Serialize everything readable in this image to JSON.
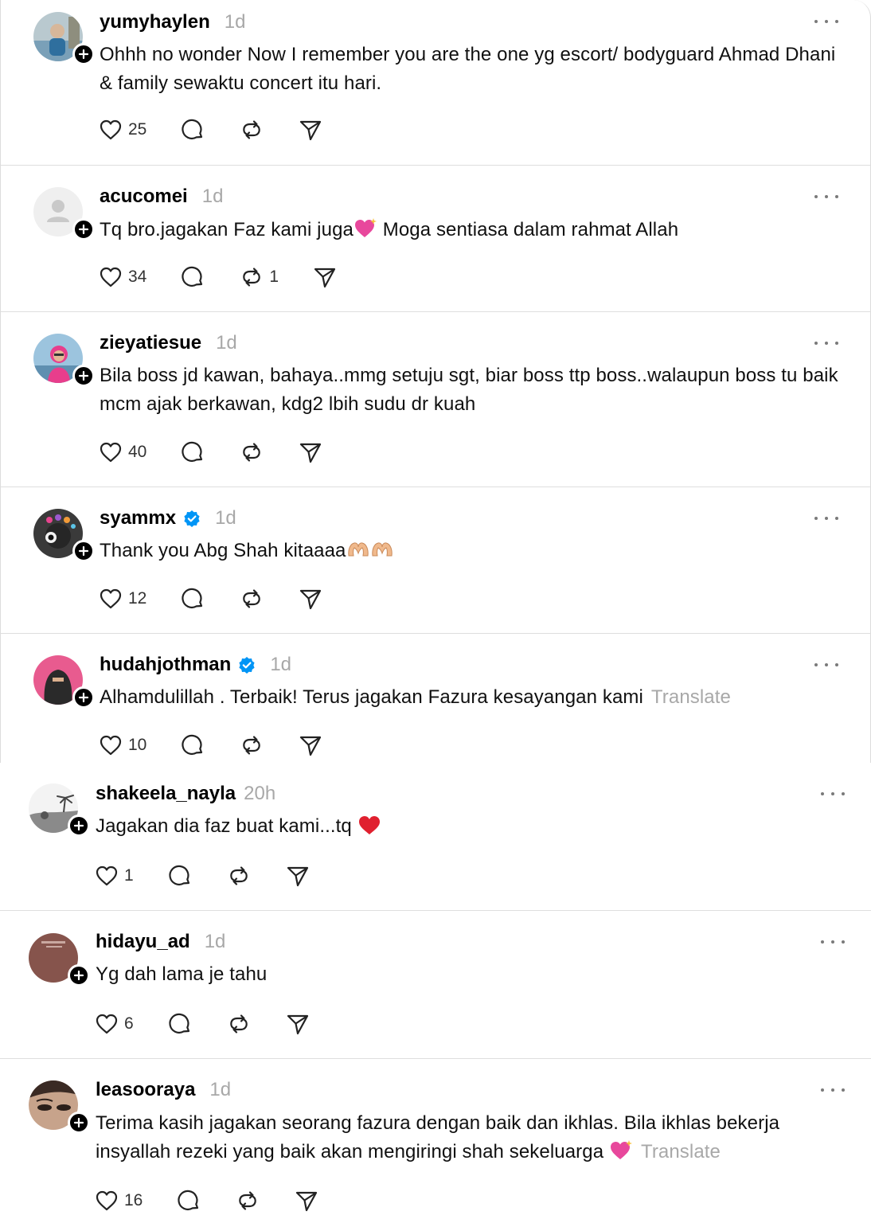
{
  "posts": [
    {
      "username": "yumyhaylen",
      "time": "1d",
      "verified": false,
      "text": "Ohhh no wonder Now I remember you are the one yg escort/ bodyguard Ahmad Dhani & family sewaktu concert itu hari.",
      "translate": "",
      "likes": "25",
      "replies": "",
      "reposts": "",
      "avatar_colors": [
        "#7aa0b8",
        "#2f6f9e"
      ]
    },
    {
      "username": "acucomei",
      "time": "1d",
      "verified": false,
      "text": "Tq bro.jagakan Faz kami juga",
      "text_after": " Moga sentiasa dalam rahmat Allah",
      "emoji": "sparkling-heart",
      "translate": "",
      "likes": "34",
      "replies": "",
      "reposts": "1",
      "avatar_colors": [
        "#e9e9e9",
        "#cfcfcf"
      ]
    },
    {
      "username": "zieyatiesue",
      "time": "1d",
      "verified": false,
      "text": "Bila boss jd kawan, bahaya..mmg setuju sgt, biar boss ttp boss..walaupun boss tu baik mcm ajak berkawan, kdg2 lbih sudu dr kuah",
      "translate": "",
      "likes": "40",
      "replies": "",
      "reposts": "",
      "avatar_colors": [
        "#6aa0c9",
        "#e83e8c"
      ]
    },
    {
      "username": "syammx",
      "time": "1d",
      "verified": true,
      "text": "Thank you Abg Shah kitaaaa",
      "emoji": "heart-hands",
      "translate": "",
      "likes": "12",
      "replies": "",
      "reposts": "",
      "avatar_colors": [
        "#222222",
        "#f2f2f2"
      ]
    },
    {
      "username": "hudahjothman",
      "time": "1d",
      "verified": true,
      "text": "Alhamdulillah . Terbaik! Terus jagakan Fazura kesayangan kami",
      "translate": "Translate",
      "likes": "10",
      "replies": "",
      "reposts": "",
      "avatar_colors": [
        "#e85b8f",
        "#2a2a2a"
      ]
    },
    {
      "username": "shakeela_nayla",
      "time": "20h",
      "verified": false,
      "text": "Jagakan dia faz buat kami...tq",
      "emoji": "red-heart",
      "translate": "",
      "likes": "1",
      "replies": "",
      "reposts": "",
      "avatar_colors": [
        "#f4f4f4",
        "#6c6c6c"
      ]
    },
    {
      "username": "hidayu_ad",
      "time": "1d",
      "verified": false,
      "text": "Yg dah lama je tahu",
      "translate": "",
      "likes": "6",
      "replies": "",
      "reposts": "",
      "avatar_colors": [
        "#8a5a52",
        "#6b423c"
      ]
    },
    {
      "username": "leasooraya",
      "time": "1d",
      "verified": false,
      "text": "Terima kasih jagakan seorang fazura dengan baik dan ikhlas. Bila ikhlas bekerja insyallah rezeki yang baik akan mengiringi shah sekeluarga",
      "emoji": "sparkling-heart",
      "translate": "Translate",
      "likes": "16",
      "replies": "",
      "reposts": "",
      "avatar_colors": [
        "#c9a58e",
        "#2b1f1a"
      ]
    }
  ],
  "icons": {
    "like": "heart-outline-icon",
    "reply": "speech-bubble-icon",
    "repost": "repost-icon",
    "share": "send-icon",
    "more": "more-icon",
    "follow": "plus-icon",
    "verified": "verified-badge-icon"
  },
  "colors": {
    "verified": "#0095f6",
    "secondary_text": "#a8a8a8",
    "sparkling_heart": "#e8489c",
    "red_heart": "#e0202f"
  }
}
